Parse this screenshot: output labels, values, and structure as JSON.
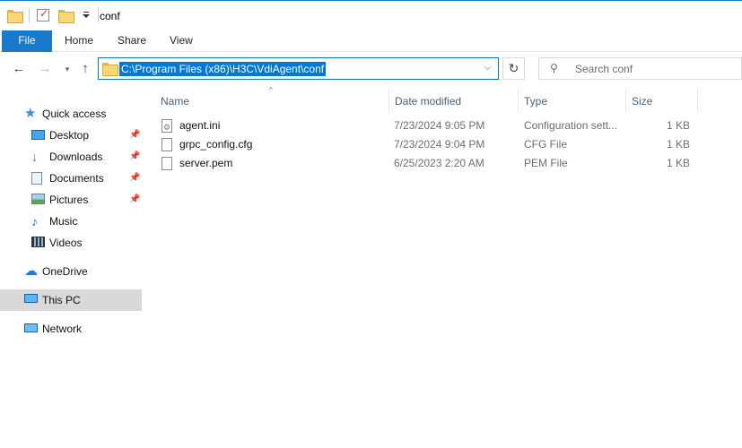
{
  "window": {
    "title": "conf"
  },
  "ribbon": {
    "tabs": [
      "File",
      "Home",
      "Share",
      "View"
    ]
  },
  "nav": {
    "address": "C:\\Program Files (x86)\\H3C\\VdiAgent\\conf",
    "search_placeholder": "Search conf"
  },
  "sidebar": {
    "quick_access": "Quick access",
    "items": [
      {
        "label": "Desktop",
        "icon": "desktop-icon",
        "pinned": true
      },
      {
        "label": "Downloads",
        "icon": "download-icon",
        "pinned": true
      },
      {
        "label": "Documents",
        "icon": "documents-icon",
        "pinned": true
      },
      {
        "label": "Pictures",
        "icon": "pictures-icon",
        "pinned": true
      },
      {
        "label": "Music",
        "icon": "music-icon",
        "pinned": false
      },
      {
        "label": "Videos",
        "icon": "videos-icon",
        "pinned": false
      }
    ],
    "onedrive": "OneDrive",
    "this_pc": "This PC",
    "network": "Network"
  },
  "columns": {
    "name": "Name",
    "date": "Date modified",
    "type": "Type",
    "size": "Size"
  },
  "files": [
    {
      "name": "agent.ini",
      "date": "7/23/2024 9:05 PM",
      "type": "Configuration sett...",
      "size": "1 KB",
      "icon": "config-file-icon"
    },
    {
      "name": "grpc_config.cfg",
      "date": "7/23/2024 9:04 PM",
      "type": "CFG File",
      "size": "1 KB",
      "icon": "file-icon"
    },
    {
      "name": "server.pem",
      "date": "6/25/2023 2:20 AM",
      "type": "PEM File",
      "size": "1 KB",
      "icon": "file-icon"
    }
  ],
  "colors": {
    "accent": "#1979ca",
    "selection": "#0078d7",
    "sidebar_selected": "#d9d9d9"
  }
}
